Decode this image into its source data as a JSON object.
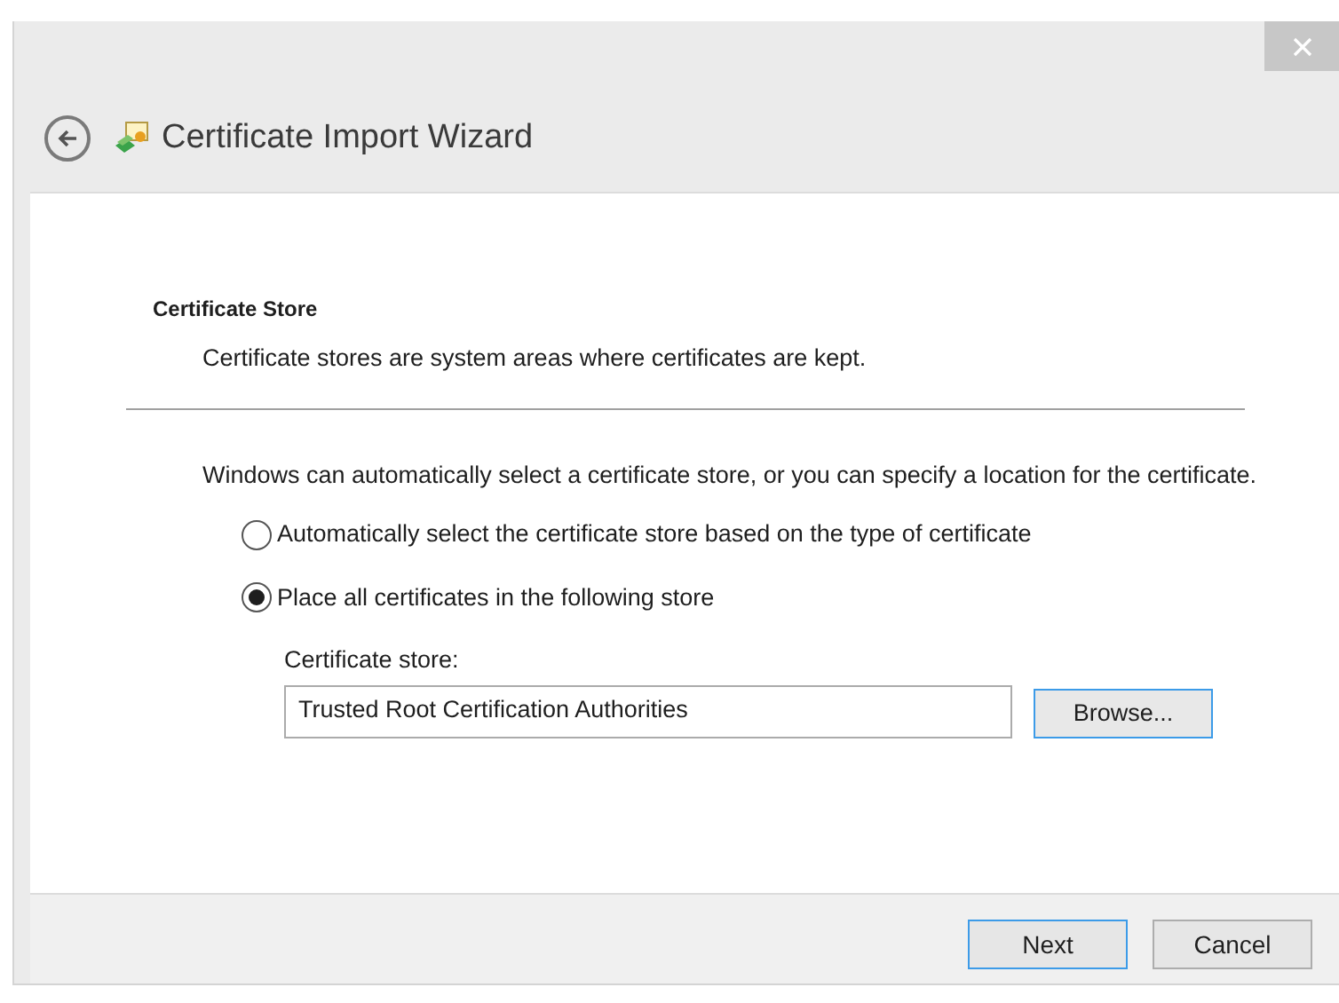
{
  "window": {
    "title": "Certificate Import Wizard"
  },
  "page": {
    "heading": "Certificate Store",
    "subheading": "Certificate stores are system areas where certificates are kept.",
    "intro": "Windows can automatically select a certificate store, or you can specify a location for the certificate.",
    "options": [
      {
        "label": "Automatically select the certificate store based on the type of certificate",
        "selected": false
      },
      {
        "label": "Place all certificates in the following store",
        "selected": true
      }
    ],
    "store_label": "Certificate store:",
    "store_value": "Trusted Root Certification Authorities",
    "browse_button": "Browse..."
  },
  "buttons": [
    {
      "label": "Next",
      "focused": true
    },
    {
      "label": "Cancel",
      "focused": false
    }
  ]
}
